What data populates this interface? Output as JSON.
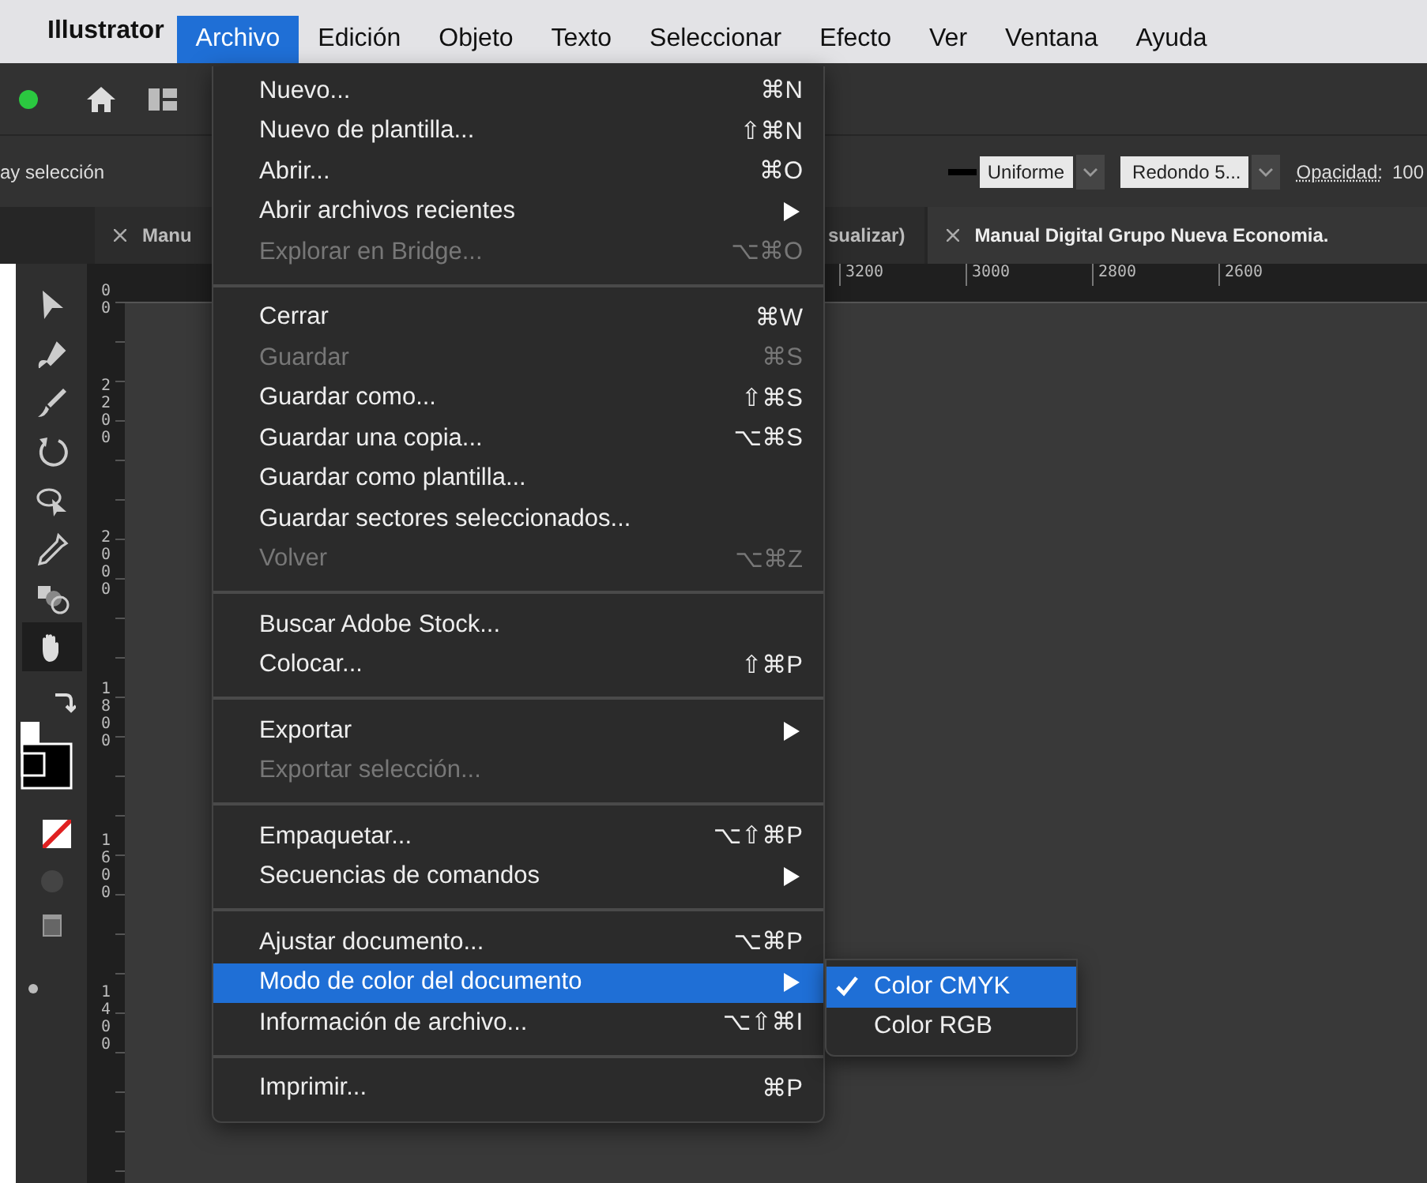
{
  "menubar": {
    "app_name": "Illustrator",
    "items": [
      {
        "label": "Archivo",
        "selected": true
      },
      {
        "label": "Edición",
        "selected": false
      },
      {
        "label": "Objeto",
        "selected": false
      },
      {
        "label": "Texto",
        "selected": false
      },
      {
        "label": "Seleccionar",
        "selected": false
      },
      {
        "label": "Efecto",
        "selected": false
      },
      {
        "label": "Ver",
        "selected": false
      },
      {
        "label": "Ventana",
        "selected": false
      },
      {
        "label": "Ayuda",
        "selected": false
      }
    ]
  },
  "control_bar": {
    "selection_label": "ay selección",
    "stroke_profile": "Uniforme",
    "brush": "Redondo 5...",
    "opacity_label": "Opacidad:",
    "opacity_value": "100"
  },
  "tabs": [
    {
      "label": "Manu",
      "close": true,
      "selected": false
    },
    {
      "label": "sualizar)",
      "close": false,
      "selected": false
    },
    {
      "label": "Manual Digital Grupo Nueva Economia.",
      "close": true,
      "selected": true
    }
  ],
  "rulers": {
    "horizontal": [
      "3200",
      "3000",
      "2800",
      "2600"
    ],
    "vertical": [
      "00",
      "2200",
      "2000",
      "1800",
      "1600",
      "1400"
    ]
  },
  "file_menu": {
    "groups": [
      [
        {
          "label": "Nuevo...",
          "shortcut": "⌘N",
          "submenu": false,
          "disabled": false,
          "selected": false
        },
        {
          "label": "Nuevo de plantilla...",
          "shortcut": "⇧⌘N",
          "submenu": false,
          "disabled": false,
          "selected": false
        },
        {
          "label": "Abrir...",
          "shortcut": "⌘O",
          "submenu": false,
          "disabled": false,
          "selected": false
        },
        {
          "label": "Abrir archivos recientes",
          "submenu": true,
          "disabled": false,
          "selected": false
        },
        {
          "label": "Explorar en Bridge...",
          "shortcut": "⌥⌘O",
          "submenu": false,
          "disabled": true,
          "selected": false
        }
      ],
      [
        {
          "label": "Cerrar",
          "shortcut": "⌘W",
          "submenu": false,
          "disabled": false,
          "selected": false
        },
        {
          "label": "Guardar",
          "shortcut": "⌘S",
          "submenu": false,
          "disabled": true,
          "selected": false
        },
        {
          "label": "Guardar como...",
          "shortcut": "⇧⌘S",
          "submenu": false,
          "disabled": false,
          "selected": false
        },
        {
          "label": "Guardar una copia...",
          "shortcut": "⌥⌘S",
          "submenu": false,
          "disabled": false,
          "selected": false
        },
        {
          "label": "Guardar como plantilla...",
          "submenu": false,
          "disabled": false,
          "selected": false
        },
        {
          "label": "Guardar sectores seleccionados...",
          "submenu": false,
          "disabled": false,
          "selected": false
        },
        {
          "label": "Volver",
          "shortcut": "⌥⌘Z",
          "submenu": false,
          "disabled": true,
          "selected": false
        }
      ],
      [
        {
          "label": "Buscar Adobe Stock...",
          "submenu": false,
          "disabled": false,
          "selected": false
        },
        {
          "label": "Colocar...",
          "shortcut": "⇧⌘P",
          "submenu": false,
          "disabled": false,
          "selected": false
        }
      ],
      [
        {
          "label": "Exportar",
          "submenu": true,
          "disabled": false,
          "selected": false
        },
        {
          "label": "Exportar selección...",
          "submenu": false,
          "disabled": true,
          "selected": false
        }
      ],
      [
        {
          "label": "Empaquetar...",
          "shortcut": "⌥⇧⌘P",
          "submenu": false,
          "disabled": false,
          "selected": false
        },
        {
          "label": "Secuencias de comandos",
          "submenu": true,
          "disabled": false,
          "selected": false
        }
      ],
      [
        {
          "label": "Ajustar documento...",
          "shortcut": "⌥⌘P",
          "submenu": false,
          "disabled": false,
          "selected": false
        },
        {
          "label": "Modo de color del documento",
          "submenu": true,
          "disabled": false,
          "selected": true
        },
        {
          "label": "Información de archivo...",
          "shortcut": "⌥⇧⌘I",
          "submenu": false,
          "disabled": false,
          "selected": false
        }
      ],
      [
        {
          "label": "Imprimir...",
          "shortcut": "⌘P",
          "submenu": false,
          "disabled": false,
          "selected": false
        }
      ]
    ]
  },
  "color_mode_submenu": [
    {
      "label": "Color CMYK",
      "checked": true,
      "selected": true
    },
    {
      "label": "Color RGB",
      "checked": false,
      "selected": false
    }
  ]
}
